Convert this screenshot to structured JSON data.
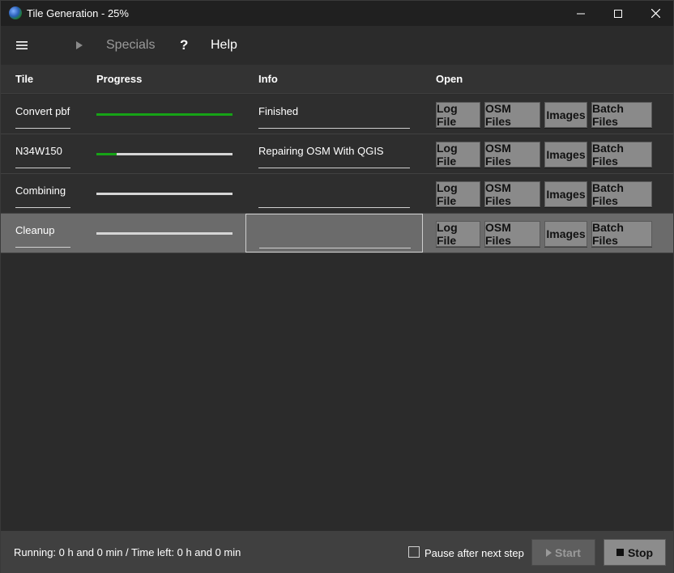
{
  "window": {
    "title": "Tile Generation - 25%",
    "icon": "globe-icon"
  },
  "menu": {
    "hamburger_icon": "hamburger-icon",
    "play_icon": "play-icon",
    "specials_label": "Specials",
    "help_symbol": "?",
    "help_label": "Help"
  },
  "table": {
    "columns": {
      "tile": "Tile",
      "progress": "Progress",
      "info": "Info",
      "open": "Open"
    },
    "button_labels": {
      "log": "Log File",
      "osm": "OSM Files",
      "images": "Images",
      "batch": "Batch Files"
    },
    "rows": [
      {
        "tile": "Convert pbf",
        "progress": 1.0,
        "info": "Finished",
        "selected": false
      },
      {
        "tile": "N34W150",
        "progress": 0.15,
        "info": "Repairing OSM With QGIS",
        "selected": false
      },
      {
        "tile": "Combining",
        "progress": 0.0,
        "info": "",
        "selected": false
      },
      {
        "tile": "Cleanup",
        "progress": 0.0,
        "info": "",
        "selected": true
      }
    ]
  },
  "footer": {
    "status": "Running: 0 h and 0 min   /   Time left: 0 h and 0 min",
    "pause_label": "Pause after next step",
    "pause_checked": false,
    "start_label": "Start",
    "stop_label": "Stop"
  },
  "colors": {
    "progress_fill": "#16a316",
    "progress_track": "#d6d6d6",
    "selected_row": "#6b6b6b"
  }
}
